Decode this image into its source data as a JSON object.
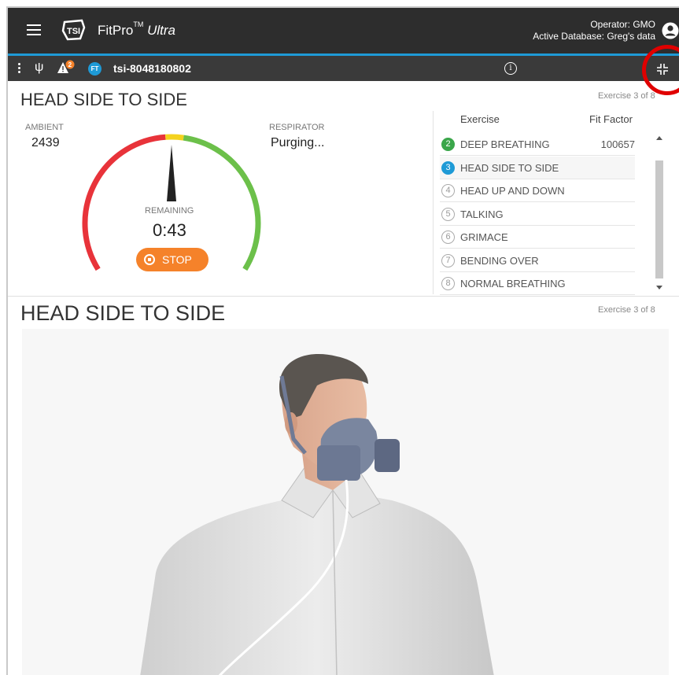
{
  "app": {
    "brand_name": "FitPro",
    "brand_tm": "TM",
    "brand_edition": "Ultra",
    "operator_line": "Operator:  GMO",
    "database_line": "Active Database:  Greg's data",
    "logo_text": "TSI"
  },
  "device_bar": {
    "warning_count": "2",
    "ft_badge": "FT",
    "device_name": "tsi-8048180802",
    "info_glyph": "i"
  },
  "test": {
    "title": "HEAD SIDE TO SIDE",
    "exercise_counter": "Exercise 3 of 8",
    "ambient_label": "AMBIENT",
    "ambient_value": "2439",
    "respirator_label": "RESPIRATOR",
    "respirator_value": "Purging...",
    "remaining_label": "REMAINING",
    "remaining_value": "0:43",
    "stop_label": "STOP",
    "gauge_needle_fraction": 0.5
  },
  "exercise_list": {
    "header_exercise": "Exercise",
    "header_fit_factor": "Fit Factor",
    "rows": [
      {
        "num": "2",
        "name": "DEEP BREATHING",
        "fit_factor": "100657",
        "state": "done"
      },
      {
        "num": "3",
        "name": "HEAD SIDE TO SIDE",
        "fit_factor": "",
        "state": "active"
      },
      {
        "num": "4",
        "name": "HEAD UP AND DOWN",
        "fit_factor": "",
        "state": "pending"
      },
      {
        "num": "5",
        "name": "TALKING",
        "fit_factor": "",
        "state": "pending"
      },
      {
        "num": "6",
        "name": "GRIMACE",
        "fit_factor": "",
        "state": "pending"
      },
      {
        "num": "7",
        "name": "BENDING OVER",
        "fit_factor": "",
        "state": "pending"
      },
      {
        "num": "8",
        "name": "NORMAL BREATHING",
        "fit_factor": "",
        "state": "pending"
      }
    ]
  },
  "instruction": {
    "title": "HEAD SIDE TO SIDE",
    "exercise_counter": "Exercise 3 of 8"
  },
  "colors": {
    "accent_blue": "#1e9ad6",
    "done_green": "#3aa64a",
    "stop_orange": "#f5822a",
    "highlight_red": "#e00000",
    "gauge_red": "#e8333a",
    "gauge_yellow": "#f4d21e",
    "gauge_green": "#6cc04a"
  }
}
